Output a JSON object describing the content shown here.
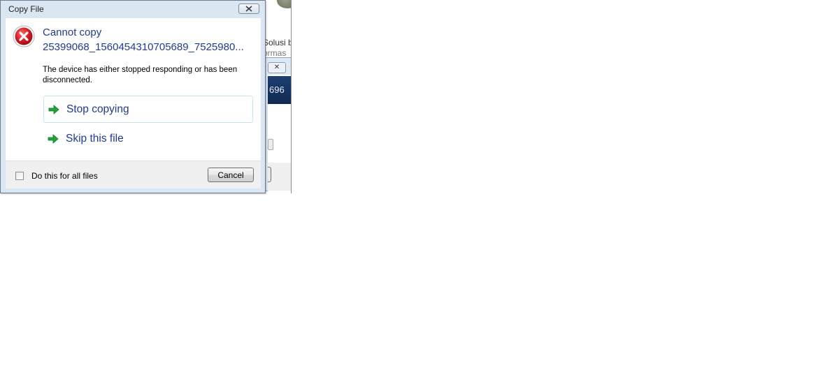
{
  "background_window": {
    "text_line_1": "Solusi b",
    "text_line_2": "ormas",
    "banner_text": "696",
    "close_icon": "close-icon"
  },
  "dialog": {
    "title": "Copy File",
    "close_icon": "close-icon",
    "error_icon": "error-icon",
    "heading": "Cannot copy",
    "filename": "25399068_1560454310705689_7525980...",
    "message": "The device has either stopped responding or has been disconnected.",
    "options": [
      {
        "label": "Stop copying",
        "icon": "green-arrow-icon"
      },
      {
        "label": "Skip this file",
        "icon": "green-arrow-icon"
      }
    ],
    "footer": {
      "checkbox_label": "Do this for all files",
      "checkbox_checked": false,
      "cancel_label": "Cancel"
    }
  },
  "colors": {
    "link_blue": "#1e3a9a",
    "error_red": "#c8161d",
    "arrow_green": "#1fa33a",
    "frame": "#dbe6f3"
  }
}
